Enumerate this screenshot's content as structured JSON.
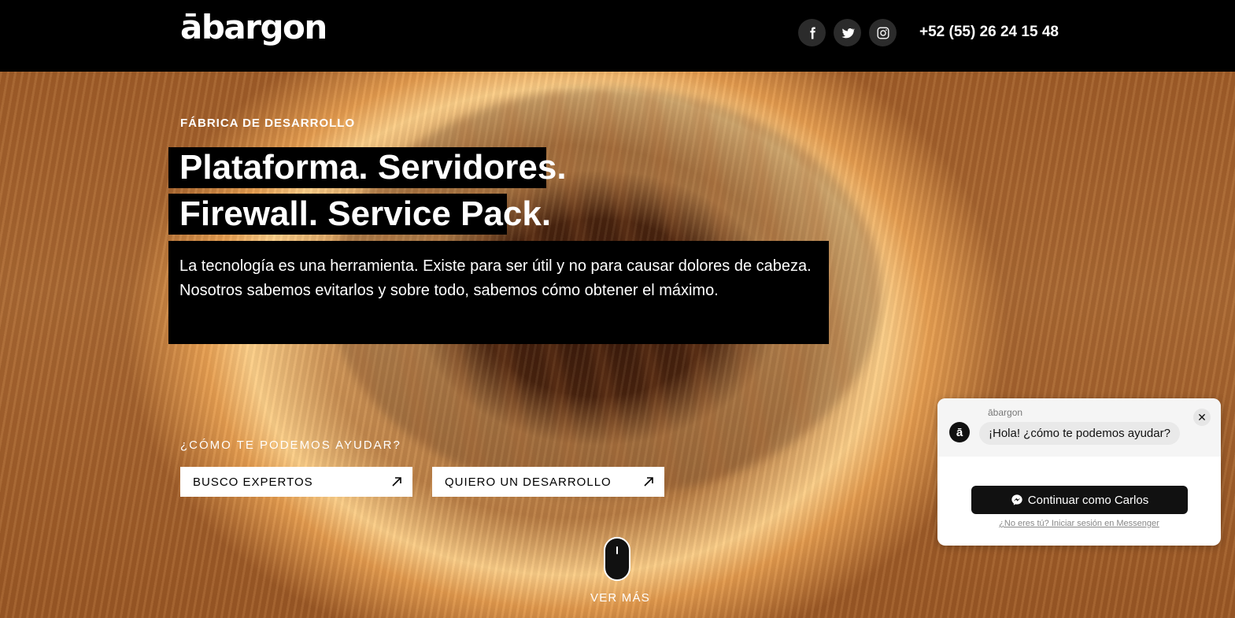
{
  "header": {
    "logo": "ābargon",
    "phone": "+52 (55) 26 24 15 48",
    "socials": [
      {
        "name": "facebook",
        "icon": "facebook-icon"
      },
      {
        "name": "twitter",
        "icon": "twitter-icon"
      },
      {
        "name": "instagram",
        "icon": "instagram-icon"
      }
    ]
  },
  "hero": {
    "kicker": "FÁBRICA DE DESARROLLO",
    "headline_line1": "Plataforma. Servidores.",
    "headline_line2": "Firewall. Service Pack.",
    "description_line1": "La tecnología es una herramienta. Existe para ser útil y no para causar dolores de cabeza.",
    "description_line2": "Nosotros sabemos evitarlos y sobre todo, sabemos cómo obtener el máximo.",
    "help_prompt": "¿CÓMO TE PODEMOS AYUDAR?",
    "button1": "BUSCO EXPERTOS",
    "button2": "QUIERO UN DESARROLLO",
    "scroll_label": "VER MÁS"
  },
  "chat": {
    "page_name": "ābargon",
    "avatar_letter": "ā",
    "message": "¡Hola! ¿cómo te podemos ayudar?",
    "continue_button": "Continuar como Carlos",
    "alt_link": "¿No eres tú? Iniciar sesión en Messenger"
  },
  "colors": {
    "header_bg": "#000000",
    "button_bg": "#ffffff",
    "chat_cta_bg": "#111111"
  }
}
